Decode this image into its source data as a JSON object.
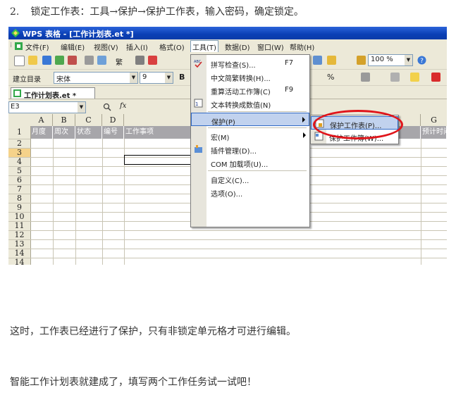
{
  "instructions": {
    "step_number": "2.",
    "step_text": "锁定工作表：工具→保护→保护工作表，输入密码，确定锁定。",
    "para1": "这时，工作表已经进行了保护，只有非锁定单元格才可进行编辑。",
    "para2": "智能工作计划表就建成了，填写两个工作任务试一试吧！"
  },
  "app": {
    "title": "WPS 表格 - [工作计划表.et *]",
    "menus": [
      "文件(F)",
      "编辑(E)",
      "视图(V)",
      "插入(I)",
      "格式(O)",
      "工具(T)",
      "数据(D)",
      "窗口(W)",
      "帮助(H)"
    ],
    "toolbar1": {
      "font_style_glyph": "繁",
      "zoom": "100 %"
    },
    "toolbar2": {
      "catalog_label": "建立目录",
      "font_name": "宋体",
      "font_size": "9",
      "bold": "B",
      "percent": "%"
    },
    "document_tab": "工作计划表.et *",
    "name_box": "E3",
    "fx_label": "fx",
    "column_headers": [
      "A",
      "B",
      "C",
      "D",
      "G"
    ],
    "table_headers": [
      "月度",
      "周次",
      "状态",
      "编号",
      "工作事项",
      "预计时间"
    ],
    "row_numbers": [
      "1",
      "2",
      "3",
      "4",
      "5",
      "6",
      "7",
      "8",
      "9",
      "10",
      "11",
      "12",
      "13",
      "14"
    ],
    "tools_menu": [
      {
        "label": "拼写检查(S)...",
        "shortcut": "F7"
      },
      {
        "label": "中文简繁转换(H)..."
      },
      {
        "label": "重算活动工作簿(C)",
        "shortcut": "F9"
      },
      {
        "label": "文本转换成数值(N)"
      },
      {
        "label": "保护(P)"
      },
      {
        "label": "宏(M)"
      },
      {
        "label": "插件管理(D)..."
      },
      {
        "label": "COM 加载项(U)..."
      },
      {
        "label": "自定义(C)..."
      },
      {
        "label": "选项(O)..."
      }
    ],
    "protect_submenu": [
      "保护工作表(P)...",
      "保护工作簿(W)..."
    ]
  },
  "colors": {
    "title_bar": "#0A3FB5",
    "menu_highlight": "#C1D2EE",
    "header_fill": "#A7A6AA",
    "annotation": "#E0151B"
  }
}
